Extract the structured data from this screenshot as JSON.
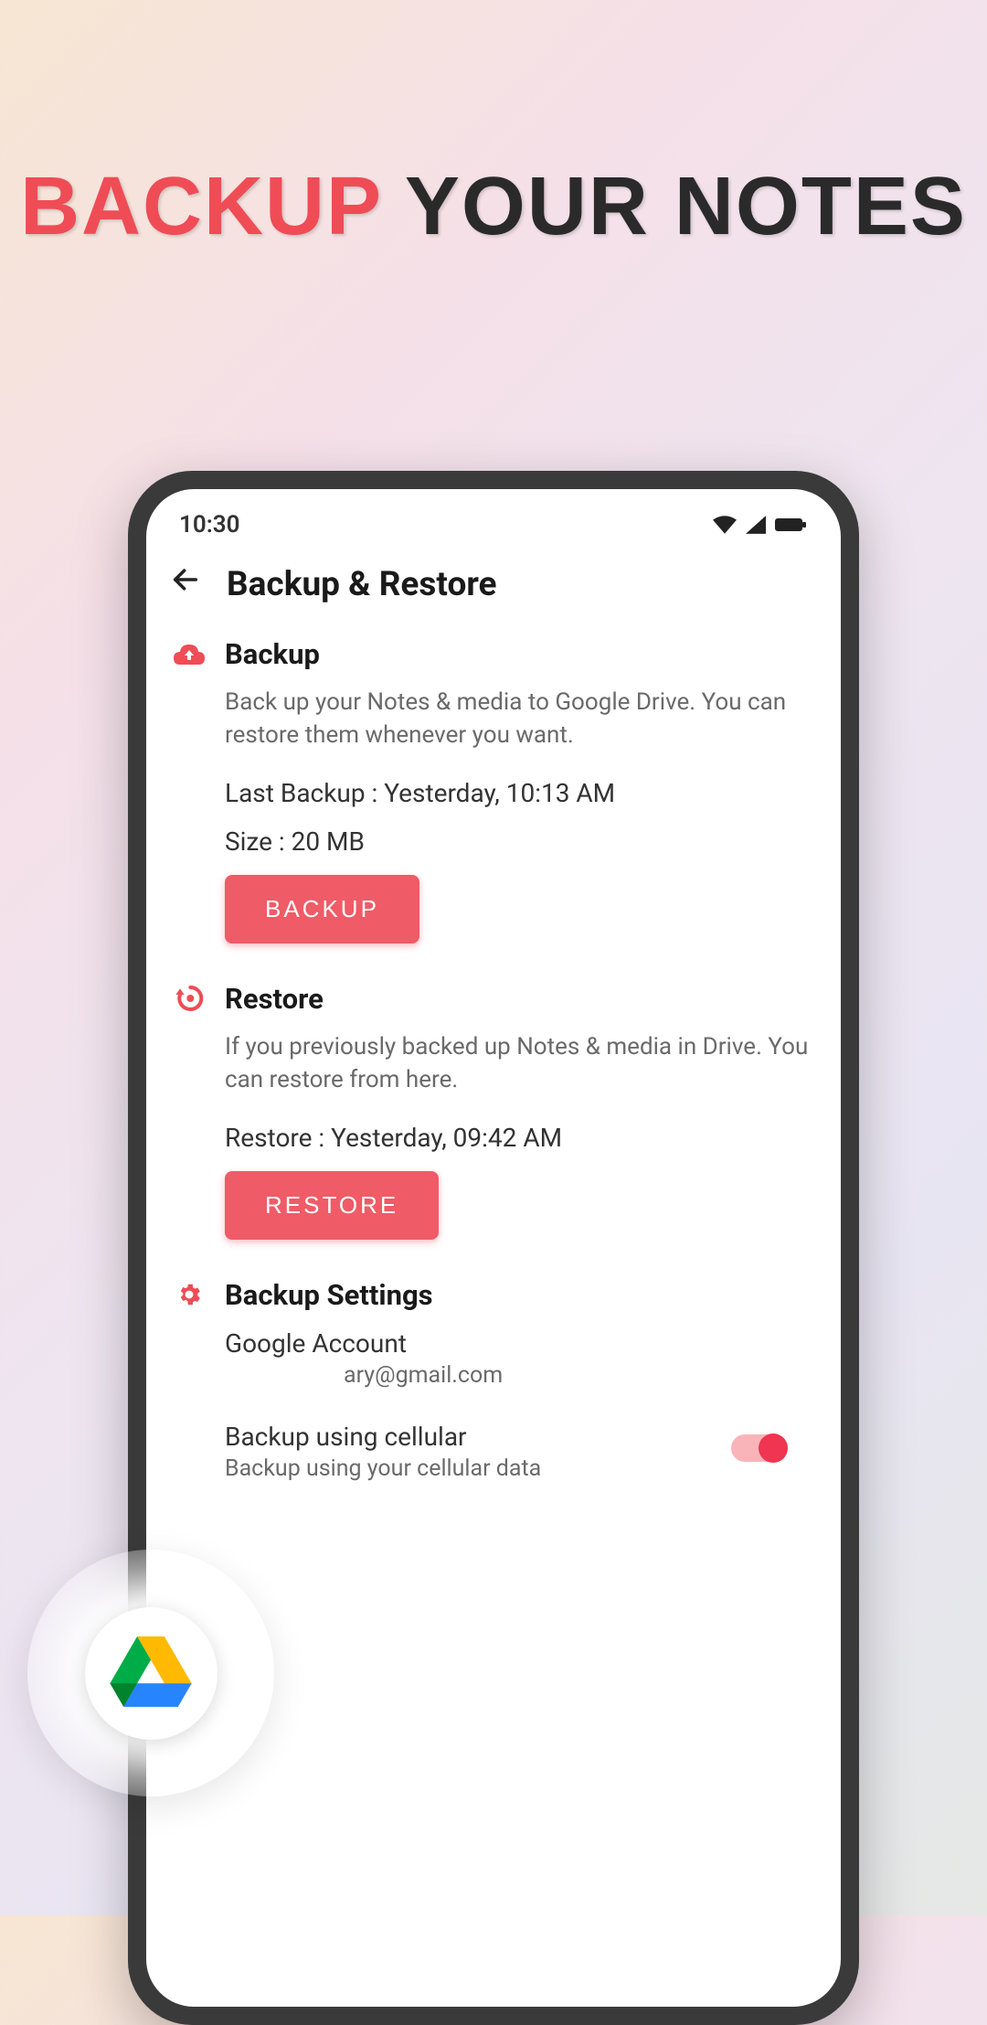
{
  "hero": {
    "word1": "BACKUP",
    "word2": "YOUR NOTES"
  },
  "status": {
    "time": "10:30"
  },
  "appbar": {
    "title": "Backup & Restore"
  },
  "backup": {
    "title": "Backup",
    "desc": "Back up your Notes & media to Google Drive. You can restore them whenever you want.",
    "last": "Last Backup : Yesterday, 10:13 AM",
    "size": "Size : 20 MB",
    "button": "BACKUP"
  },
  "restore": {
    "title": "Restore",
    "desc": "If you previously backed up Notes & media in Drive. You can restore from here.",
    "last": "Restore : Yesterday, 09:42 AM",
    "button": "RESTORE"
  },
  "settings": {
    "title": "Backup Settings",
    "account_label": "Google Account",
    "account_value": "ary@gmail.com",
    "cellular_label": "Backup using cellular",
    "cellular_sub": "Backup using your cellular data",
    "cellular_on": true
  }
}
